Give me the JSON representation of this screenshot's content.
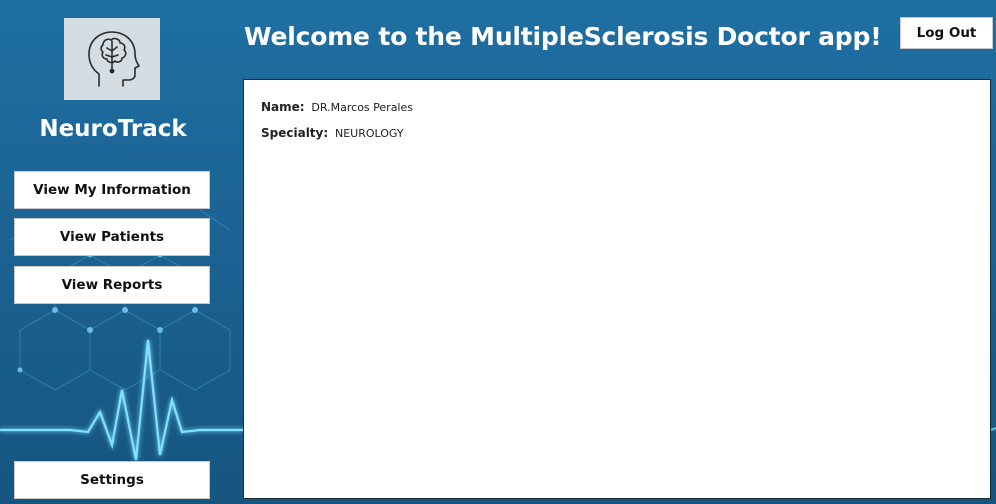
{
  "app": {
    "brand": "NeuroTrack",
    "title": "Welcome to the MultipleSclerosis Doctor app!",
    "logo_icon": "brain-head-icon"
  },
  "sidebar": {
    "items": [
      {
        "label": "View My Information"
      },
      {
        "label": "View Patients"
      },
      {
        "label": "View Reports"
      }
    ],
    "settings_label": "Settings"
  },
  "header": {
    "logout_label": "Log Out"
  },
  "doctor": {
    "name_label": "Name:",
    "name_value": "DR.Marcos Perales",
    "specialty_label": "Specialty:",
    "specialty_value": "NEUROLOGY"
  },
  "colors": {
    "background": "#1f6fa3",
    "panel": "#ffffff",
    "accent_glow": "#7fe3ff"
  }
}
